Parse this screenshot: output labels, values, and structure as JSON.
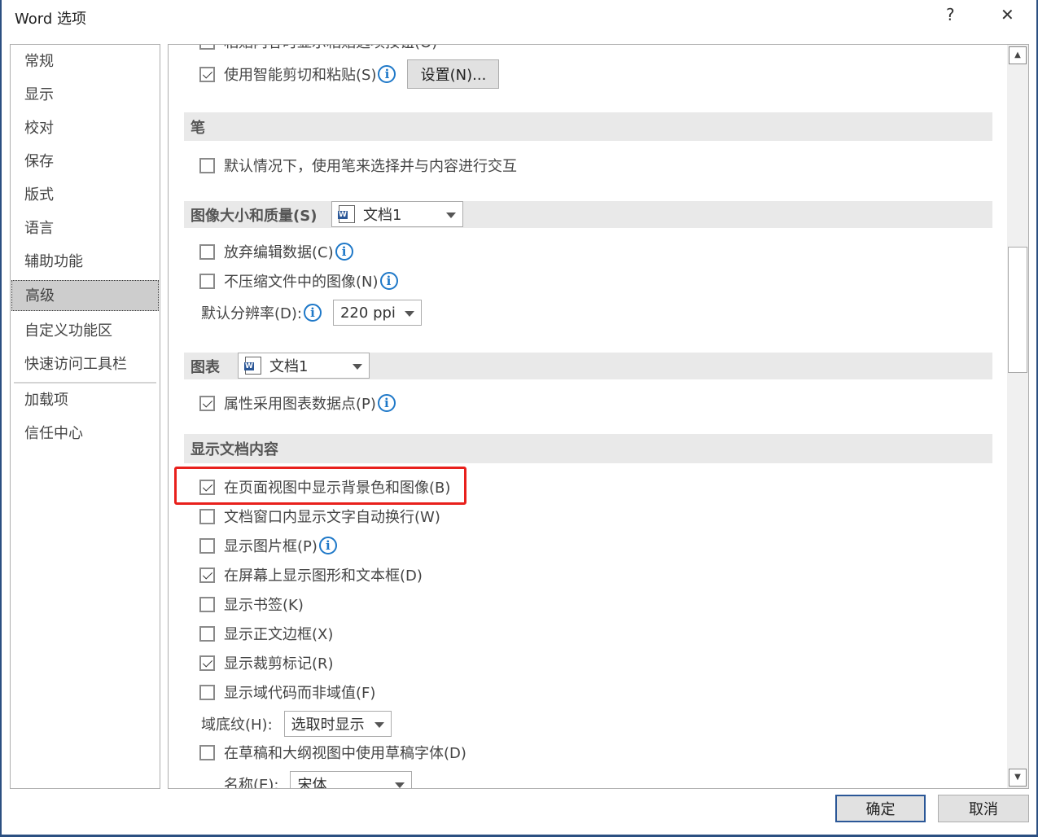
{
  "window": {
    "title": "Word 选项",
    "help": "?",
    "close": "✕"
  },
  "sidebar": {
    "items": [
      "常规",
      "显示",
      "校对",
      "保存",
      "版式",
      "语言",
      "辅助功能",
      "高级",
      "自定义功能区",
      "快速访问工具栏",
      "加载项",
      "信任中心"
    ],
    "selected": "高级"
  },
  "content": {
    "cut_top": "粘贴内容时显示粘贴选项按钮(O)",
    "smart_cut": {
      "label": "使用智能剪切和粘贴(S)",
      "checked": true,
      "settings_button": "设置(N)..."
    },
    "pen": {
      "header": "笔",
      "option": {
        "label": "默认情况下，使用笔来选择并与内容进行交互",
        "checked": false
      }
    },
    "image": {
      "header": "图像大小和质量(S)",
      "doc": "文档1",
      "options": [
        {
          "label": "放弃编辑数据(C)",
          "checked": false
        },
        {
          "label": "不压缩文件中的图像(N)",
          "checked": false
        }
      ],
      "resolution_label": "默认分辨率(D):",
      "resolution": "220 ppi"
    },
    "chart": {
      "header": "图表",
      "doc": "文档1",
      "option": {
        "label": "属性采用图表数据点(P)",
        "checked": true
      }
    },
    "display": {
      "header": "显示文档内容",
      "options": [
        {
          "label": "在页面视图中显示背景色和图像(B)",
          "checked": true
        },
        {
          "label": "文档窗口内显示文字自动换行(W)",
          "checked": false
        },
        {
          "label": "显示图片框(P)",
          "checked": false
        },
        {
          "label": "在屏幕上显示图形和文本框(D)",
          "checked": true
        },
        {
          "label": "显示书签(K)",
          "checked": false
        },
        {
          "label": "显示正文边框(X)",
          "checked": false
        },
        {
          "label": "显示裁剪标记(R)",
          "checked": true
        },
        {
          "label": "显示域代码而非域值(F)",
          "checked": false
        }
      ],
      "shading_label": "域底纹(H):",
      "shading": "选取时显示",
      "draft": {
        "label": "在草稿和大纲视图中使用草稿字体(D)",
        "checked": false
      },
      "name_label": "名称(E):",
      "name": "宋体"
    }
  },
  "footer": {
    "ok": "确定",
    "cancel": "取消"
  },
  "colors": {
    "highlight": "#e8201c",
    "info": "#1e78c8",
    "border": "#2b4f81"
  }
}
